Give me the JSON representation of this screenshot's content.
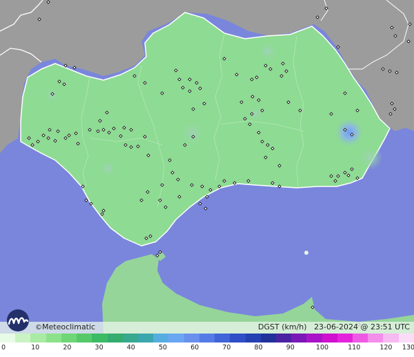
{
  "footer": {
    "copyright": "©",
    "brand": "Meteoclimatic",
    "variable": "DGST (km/h)",
    "datetime": "23-06-2024 @ 23:51 UTC"
  },
  "legend": {
    "ticks": [
      "0",
      "10",
      "20",
      "30",
      "40",
      "50",
      "60",
      "70",
      "80",
      "90",
      "100",
      "110",
      "120",
      "130"
    ],
    "colors": [
      "#e8fbe6",
      "#caf3c4",
      "#a9eaa4",
      "#8ce28a",
      "#6fd676",
      "#55c96a",
      "#3cbb66",
      "#34ac6e",
      "#36a98e",
      "#3ba7ad",
      "#56aee0",
      "#6aa6f2",
      "#6a90ee",
      "#557ce6",
      "#4164d8",
      "#2f4ec8",
      "#2440b2",
      "#20319a",
      "#4a22a2",
      "#7a18b8",
      "#a914c8",
      "#cf10cf",
      "#e522dc",
      "#ee5ae4",
      "#f38eea",
      "#f7b9f1",
      "#fbdcf7"
    ]
  },
  "map": {
    "colors": {
      "sea": "#7a86dc",
      "land_outside": "#9a9a9a",
      "region": "#8edb93",
      "border": "#ffffff",
      "station": "#111111",
      "gust_high": "#7aa3ea"
    }
  }
}
